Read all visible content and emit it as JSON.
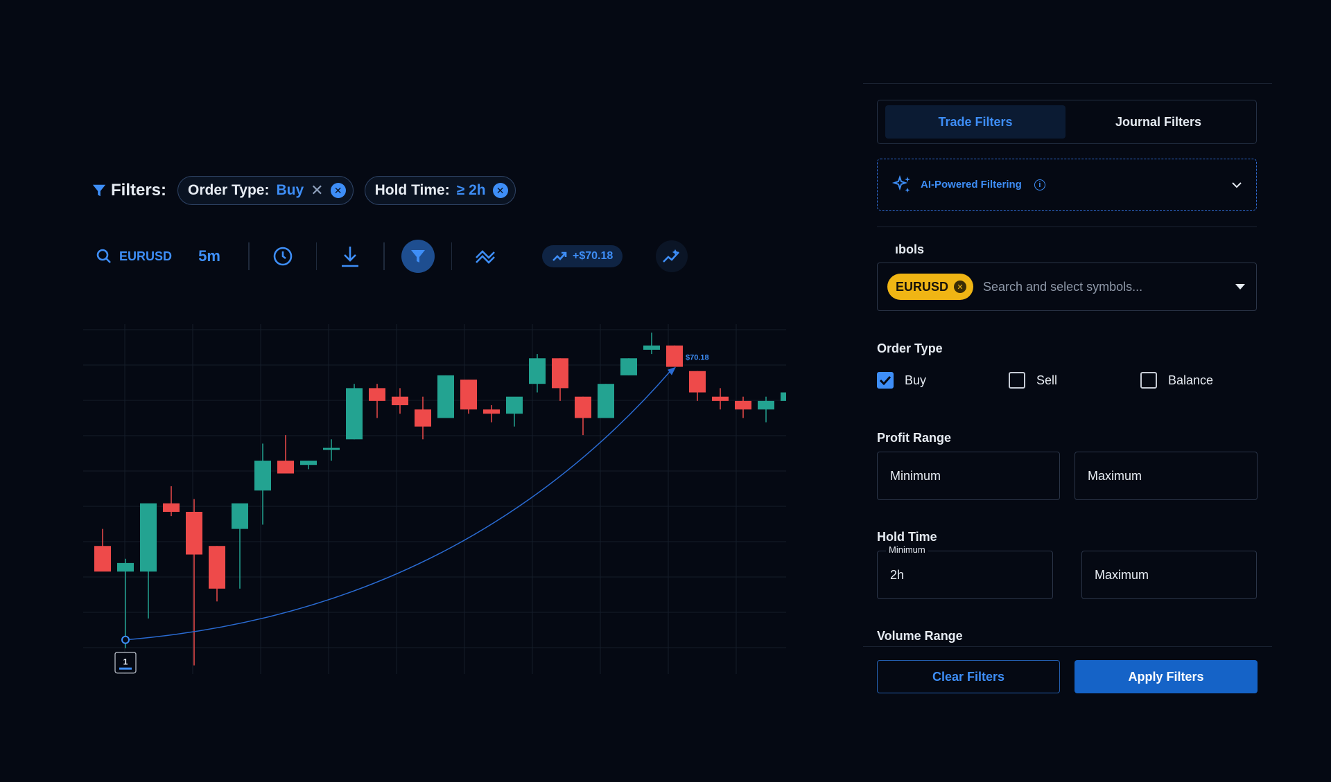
{
  "filter_bar": {
    "title": "Filters:",
    "chips": [
      {
        "key": "Order Type:",
        "value": "Buy"
      },
      {
        "key": "Hold Time:",
        "value": "≥ 2h"
      }
    ]
  },
  "toolbar": {
    "symbol": "EURUSD",
    "interval": "5m",
    "pnl": "+$70.18",
    "icons": [
      "search-icon",
      "clock-icon",
      "download-icon",
      "filter-icon",
      "trend-lines-icon",
      "trend-up-icon",
      "chart-magic-icon"
    ]
  },
  "chart_data": {
    "type": "candlestick",
    "colors": {
      "up": "#23a391",
      "down": "#ee4a4a",
      "grid": "#151d2a",
      "arrow": "#2a6bd2"
    },
    "candles": [
      {
        "o": 1.8,
        "h": 2.2,
        "l": 1.3,
        "c": 1.2
      },
      {
        "o": 1.2,
        "h": 1.5,
        "l": -0.6,
        "c": 1.4
      },
      {
        "o": 1.2,
        "h": 1.6,
        "l": 0.1,
        "c": 2.8
      },
      {
        "o": 2.8,
        "h": 3.2,
        "l": 2.5,
        "c": 2.6
      },
      {
        "o": 2.6,
        "h": 2.9,
        "l": -1.0,
        "c": 1.6
      },
      {
        "o": 1.8,
        "h": 1.8,
        "l": 0.5,
        "c": 0.8
      },
      {
        "o": 2.2,
        "h": 2.4,
        "l": 0.8,
        "c": 2.8
      },
      {
        "o": 3.1,
        "h": 4.2,
        "l": 2.3,
        "c": 3.8
      },
      {
        "o": 3.8,
        "h": 4.4,
        "l": 3.6,
        "c": 3.5
      },
      {
        "o": 3.7,
        "h": 3.8,
        "l": 3.6,
        "c": 3.8
      },
      {
        "o": 4.1,
        "h": 4.3,
        "l": 3.8,
        "c": 4.1
      },
      {
        "o": 4.3,
        "h": 5.6,
        "l": 4.3,
        "c": 5.5
      },
      {
        "o": 5.5,
        "h": 5.6,
        "l": 4.8,
        "c": 5.2
      },
      {
        "o": 5.3,
        "h": 5.5,
        "l": 4.9,
        "c": 5.1
      },
      {
        "o": 5.0,
        "h": 5.3,
        "l": 4.3,
        "c": 4.6
      },
      {
        "o": 4.8,
        "h": 5.8,
        "l": 4.8,
        "c": 5.8
      },
      {
        "o": 5.7,
        "h": 5.7,
        "l": 4.9,
        "c": 5.0
      },
      {
        "o": 5.0,
        "h": 5.1,
        "l": 4.7,
        "c": 4.9
      },
      {
        "o": 4.9,
        "h": 5.1,
        "l": 4.6,
        "c": 5.3
      },
      {
        "o": 5.6,
        "h": 6.3,
        "l": 5.4,
        "c": 6.2
      },
      {
        "o": 6.2,
        "h": 6.2,
        "l": 5.2,
        "c": 5.5
      },
      {
        "o": 5.3,
        "h": 5.3,
        "l": 4.4,
        "c": 4.8
      },
      {
        "o": 4.8,
        "h": 5.6,
        "l": 4.8,
        "c": 5.6
      },
      {
        "o": 5.8,
        "h": 6.2,
        "l": 5.8,
        "c": 6.2
      },
      {
        "o": 6.4,
        "h": 6.8,
        "l": 6.3,
        "c": 6.5
      },
      {
        "o": 6.5,
        "h": 6.5,
        "l": 6.0,
        "c": 6.0
      },
      {
        "o": 5.9,
        "h": 5.9,
        "l": 5.2,
        "c": 5.4
      },
      {
        "o": 5.3,
        "h": 5.5,
        "l": 5.0,
        "c": 5.2
      },
      {
        "o": 5.2,
        "h": 5.3,
        "l": 4.8,
        "c": 5.0
      },
      {
        "o": 5.0,
        "h": 5.3,
        "l": 4.7,
        "c": 5.2
      },
      {
        "o": 5.2,
        "h": 5.8,
        "l": 5.0,
        "c": 5.4
      }
    ],
    "ylim": [
      -1.2,
      7.0
    ],
    "arrow": {
      "from": 1,
      "to": 25,
      "from_y": -0.4,
      "to_y": 5.9
    },
    "arrow_label": "$70.18",
    "marker_label": "1"
  },
  "panel": {
    "tabs": [
      {
        "label": "Trade Filters",
        "active": true
      },
      {
        "label": "Journal Filters",
        "active": false
      }
    ],
    "ai_label": "AI-Powered Filtering",
    "symbols_label": "ıbols",
    "symbol_chip": "EURUSD",
    "symbol_placeholder": "Search and select symbols...",
    "order_type_label": "Order Type",
    "order_types": [
      {
        "label": "Buy",
        "checked": true
      },
      {
        "label": "Sell",
        "checked": false
      },
      {
        "label": "Balance",
        "checked": false
      }
    ],
    "profit_label": "Profit Range",
    "profit_min": "Minimum",
    "profit_max": "Maximum",
    "hold_label": "Hold Time",
    "hold_min_floating": "Minimum",
    "hold_min_value": "2h",
    "hold_max": "Maximum",
    "volume_label": "Volume Range",
    "clear_label": "Clear Filters",
    "apply_label": "Apply Filters"
  }
}
